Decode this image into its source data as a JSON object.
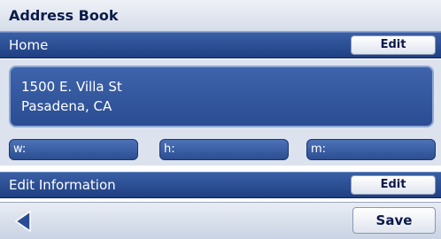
{
  "header": {
    "title": "Address Book"
  },
  "entry": {
    "name": "Home",
    "edit_label": "Edit",
    "address_line1": "1500 E. Villa St",
    "address_line2": "Pasadena, CA"
  },
  "phones": [
    {
      "label": "w:"
    },
    {
      "label": "h:"
    },
    {
      "label": "m:"
    }
  ],
  "edit_info": {
    "label": "Edit Information",
    "edit_label": "Edit"
  },
  "footer": {
    "back_icon": "left-triangle-icon",
    "save_label": "Save"
  },
  "colors": {
    "bar_blue": "#1f3f82",
    "accent_navy": "#0b1a4a",
    "panel_bg": "#dce3ee"
  }
}
